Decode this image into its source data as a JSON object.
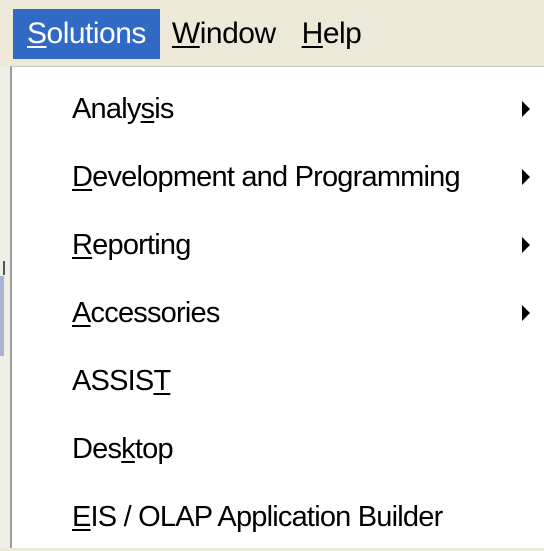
{
  "menubar": {
    "items": [
      {
        "pre": "",
        "key": "S",
        "post": "olutions"
      },
      {
        "pre": "",
        "key": "W",
        "post": "indow"
      },
      {
        "pre": "",
        "key": "H",
        "post": "elp"
      }
    ]
  },
  "dropdown": {
    "items": [
      {
        "pre": "Analy",
        "key": "s",
        "post": "is",
        "submenu": true
      },
      {
        "pre": "",
        "key": "D",
        "post": "evelopment and Programming",
        "submenu": true
      },
      {
        "pre": "",
        "key": "R",
        "post": "eporting",
        "submenu": true
      },
      {
        "pre": "",
        "key": "A",
        "post": "ccessories",
        "submenu": true
      },
      {
        "pre": "ASSIS",
        "key": "T",
        "post": "",
        "submenu": false
      },
      {
        "pre": "Des",
        "key": "k",
        "post": "top",
        "submenu": false
      },
      {
        "pre": "",
        "key": "E",
        "post": "IS / OLAP Application Builder",
        "submenu": false
      }
    ]
  },
  "colors": {
    "menubar_bg": "#ece9d8",
    "highlight": "#316ac5",
    "menu_bg": "#ffffff"
  }
}
